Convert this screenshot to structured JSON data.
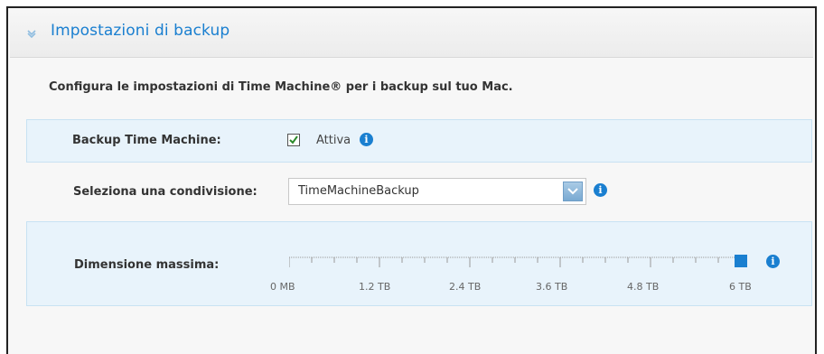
{
  "header": {
    "title": "Impostazioni di backup"
  },
  "description": "Configura le impostazioni di Time Machine® per i backup sul tuo Mac.",
  "time_machine": {
    "label": "Backup Time Machine:",
    "checked": true,
    "checkbox_label": "Attiva"
  },
  "share": {
    "label": "Seleziona una condivisione:",
    "selected": "TimeMachineBackup"
  },
  "max_size": {
    "label": "Dimensione massima:",
    "ticks": [
      "0 MB",
      "1.2 TB",
      "2.4 TB",
      "3.6 TB",
      "4.8 TB",
      "6 TB"
    ],
    "value_fraction": 1.0
  },
  "colors": {
    "accent": "#1a7fd0",
    "row_bg": "#e8f3fb",
    "slider_handle": "#1a7fd0"
  },
  "icons": {
    "collapse": "chevron-down-icon",
    "info": "info-icon",
    "check": "checkmark-icon",
    "dropdown": "dropdown-arrow-icon"
  }
}
